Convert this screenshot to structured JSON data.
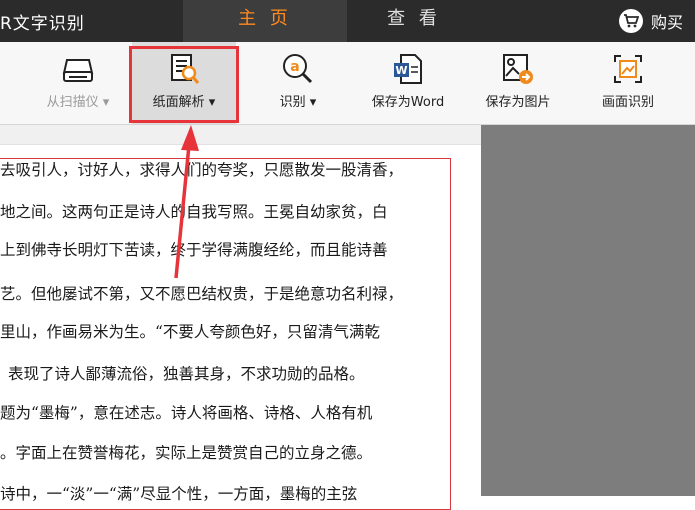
{
  "titlebar": {
    "app_title": "R文字识别",
    "tabs": [
      {
        "label": "主 页",
        "active": true
      },
      {
        "label": "查 看",
        "active": false
      }
    ],
    "buy_label": "购买"
  },
  "toolbar": {
    "items": [
      {
        "label": "从扫描仪 ▾",
        "icon": "scanner-icon",
        "enabled": false
      },
      {
        "label": "纸面解析 ▾",
        "icon": "page-analyze-icon",
        "enabled": true,
        "highlighted": true
      },
      {
        "label": "识别 ▾",
        "icon": "recognize-icon",
        "enabled": true
      },
      {
        "label": "保存为Word",
        "icon": "word-icon",
        "enabled": true
      },
      {
        "label": "保存为图片",
        "icon": "save-image-icon",
        "enabled": true
      },
      {
        "label": "画面识别",
        "icon": "screen-capture-icon",
        "enabled": true
      }
    ]
  },
  "document": {
    "lines": [
      "去吸引人，讨好人，求得人们的夸奖，只愿散发一股清香，",
      "地之间。这两句正是诗人的自我写照。王冕自幼家贫，白",
      "上到佛寺长明灯下苦读，终于学得满腹经纶，而且能诗善",
      "艺。但他屡试不第，又不愿巴结权贵，于是绝意功名利禄，",
      "里山，作画易米为生。“不要人夸颜色好，只留清气满乾",
      "表现了诗人鄙薄流俗，独善其身，不求功勋的品格。",
      "题为“墨梅”，意在述志。诗人将画格、诗格、人格有机",
      "。字面上在赞誉梅花，实际上是赞赏自己的立身之德。",
      "诗中，一“淡”一“满”尽显个性，一方面，墨梅的主弦"
    ]
  },
  "colors": {
    "accent": "#ff8a1f",
    "titlebar": "#2b2b2b",
    "highlight": "#e6343a",
    "canvas_gray": "#7d7d7d"
  }
}
